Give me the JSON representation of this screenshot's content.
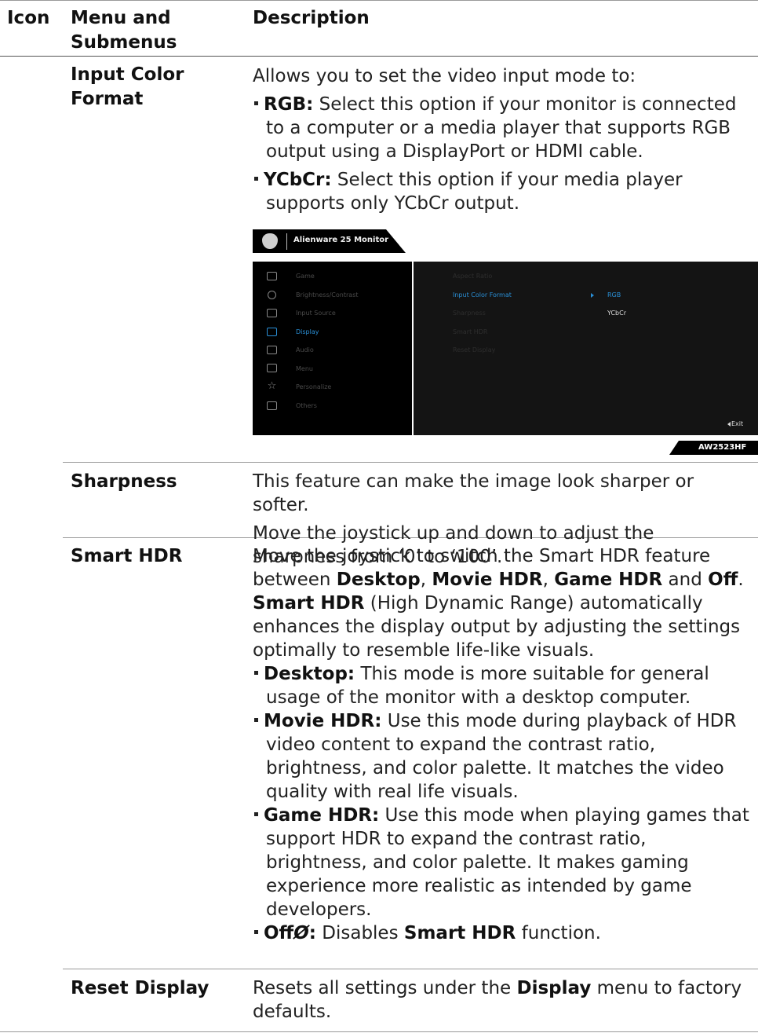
{
  "header": {
    "icon": "Icon",
    "menu": "Menu and Submenus",
    "description": "Description"
  },
  "rows": [
    {
      "menu": "Input Color Format",
      "intro": "Allows you to set the video input mode to:",
      "items": [
        {
          "term": "RGB:",
          "text": "Select this option if your monitor is connected to a computer or a media player that supports RGB output using a DisplayPort or HDMI cable."
        },
        {
          "term": "YCbCr:",
          "text": "Select this option if your media player supports only YCbCr output."
        }
      ]
    },
    {
      "menu": "Sharpness",
      "paras": [
        "This feature can make the image look sharper or softer.",
        "Move the joystick up and down to adjust the sharpness from ‘0’ to ‘100’."
      ]
    },
    {
      "menu": "Smart HDR",
      "p1": {
        "a": "Move the joystick to switch the Smart HDR feature between ",
        "b1": "Desktop",
        "c1": ", ",
        "b2": "Movie HDR",
        "c2": ", ",
        "b3": "Game HDR",
        "c3": " and ",
        "b4": "Off",
        "c4": "."
      },
      "p2": {
        "b": "Smart HDR",
        "t": " (High Dynamic Range) automatically enhances the display output by adjusting the settings optimally to resemble life-like visuals."
      },
      "items": [
        {
          "term": "Desktop:",
          "text": "This mode is more suitable for general usage of the monitor with a desktop computer."
        },
        {
          "term": "Movie HDR:",
          "text": "Use this mode during playback of HDR video content to expand the contrast ratio, brightness, and color palette. It matches the video quality with real life visuals."
        },
        {
          "term": "Game HDR:",
          "text": "Use this mode when playing games that support HDR to expand the contrast ratio, brightness, and color palette. It makes gaming experience more realistic as intended by game developers."
        },
        {
          "term": "Off",
          "symbol": "Ø",
          "colon": ":",
          "text": "Disables ",
          "b": "Smart HDR",
          "t2": " function."
        }
      ]
    },
    {
      "menu": "Reset Display",
      "a": "Resets all settings under the ",
      "b": "Display",
      "c": " menu to factory defaults."
    }
  ],
  "osd": {
    "title": "Alienware 25 Monitor",
    "menu": [
      {
        "icon": "game-icon",
        "label": "Game"
      },
      {
        "icon": "brightness-icon",
        "label": "Brightness/Contrast"
      },
      {
        "icon": "input-source-icon",
        "label": "Input Source"
      },
      {
        "icon": "display-icon",
        "label": "Display"
      },
      {
        "icon": "audio-icon",
        "label": "Audio"
      },
      {
        "icon": "menu-icon",
        "label": "Menu"
      },
      {
        "icon": "star-icon",
        "label": "Personalize"
      },
      {
        "icon": "others-icon",
        "label": "Others"
      }
    ],
    "submenu": [
      "Aspect Ratio",
      "Input Color Format",
      "Sharpness",
      "Smart HDR",
      "Reset Display"
    ],
    "options": [
      "RGB",
      "YCbCr"
    ],
    "exit": "Exit",
    "model": "AW2523HF",
    "accent": "#2a8fd6"
  }
}
